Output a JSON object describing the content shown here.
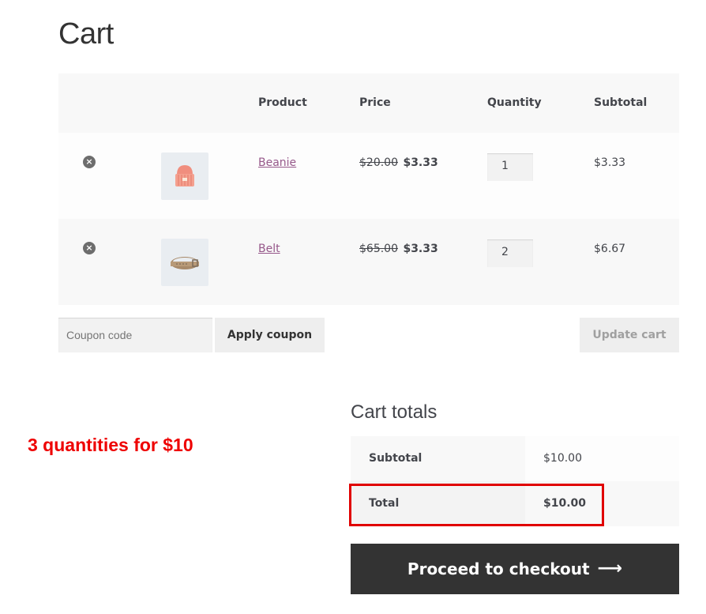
{
  "page": {
    "title": "Cart"
  },
  "cart": {
    "headers": {
      "product": "Product",
      "price": "Price",
      "quantity": "Quantity",
      "subtotal": "Subtotal"
    },
    "items": [
      {
        "name": "Beanie",
        "regular_price": "$20.00",
        "sale_price": "$3.33",
        "quantity": "1",
        "subtotal": "$3.33",
        "remove": "×",
        "thumb_icon": "beanie-icon"
      },
      {
        "name": "Belt",
        "regular_price": "$65.00",
        "sale_price": "$3.33",
        "quantity": "2",
        "subtotal": "$6.67",
        "remove": "×",
        "thumb_icon": "belt-icon"
      }
    ],
    "coupon_placeholder": "Coupon code",
    "apply_coupon_label": "Apply coupon",
    "update_cart_label": "Update cart"
  },
  "annotation": {
    "text": "3 quantities for $10",
    "color": "#ee0000"
  },
  "totals": {
    "title": "Cart totals",
    "rows": [
      {
        "label": "Subtotal",
        "value": "$10.00"
      },
      {
        "label": "Total",
        "value": "$10.00"
      }
    ],
    "checkout_label": "Proceed to checkout",
    "checkout_arrow": "⟶"
  },
  "colors": {
    "link": "#96588a",
    "button_dark": "#333333",
    "highlight": "#e00000"
  }
}
